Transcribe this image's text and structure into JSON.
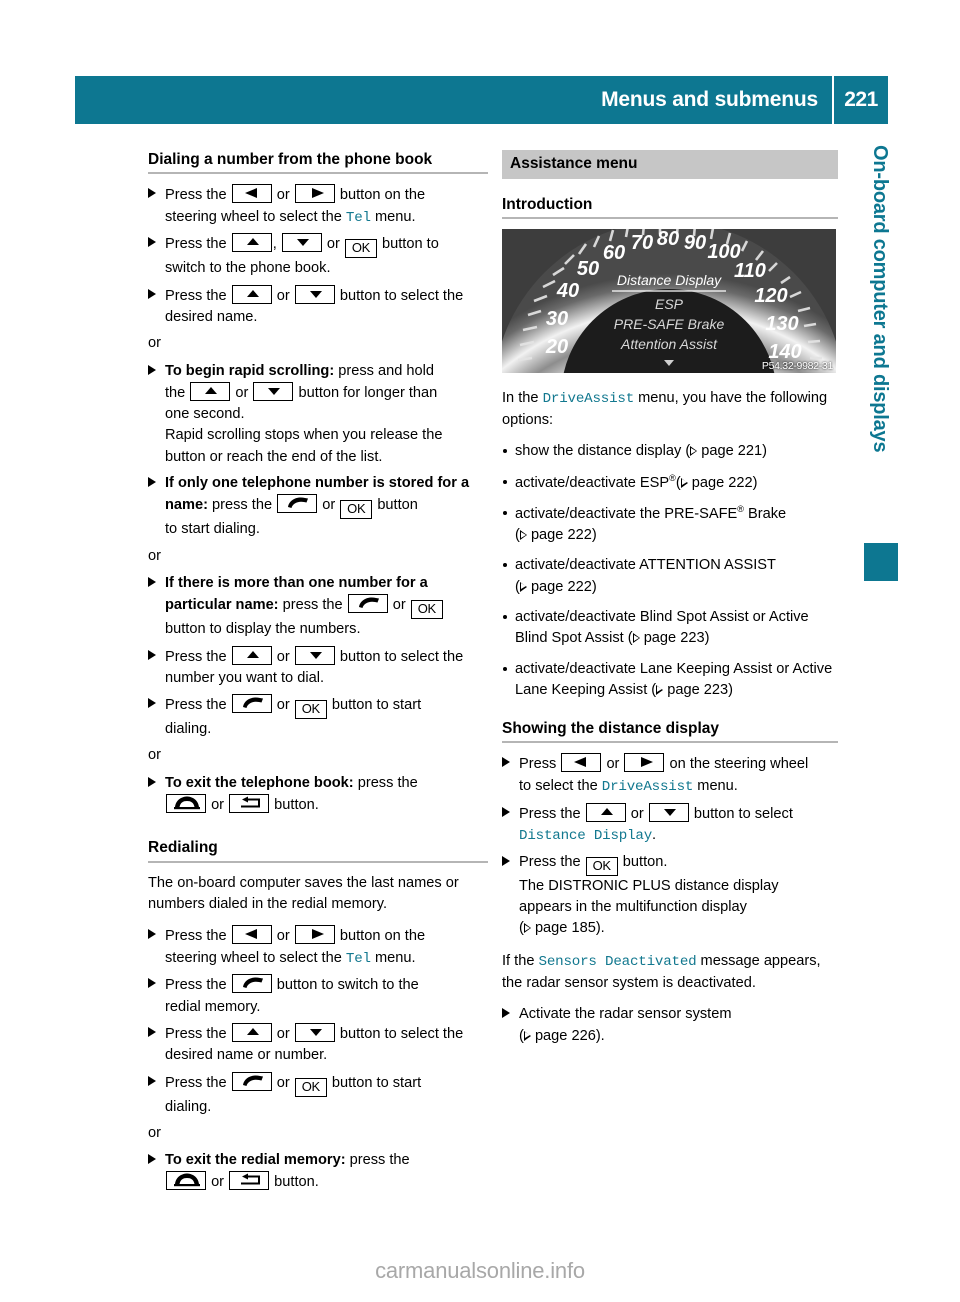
{
  "header": {
    "title": "Menus and submenus",
    "page_number": "221",
    "accent_color": "#0d7791"
  },
  "side_tab": {
    "label": "On-board computer and displays",
    "color": "#0d7791"
  },
  "watermark": "carmanualsonline.info",
  "left_column": {
    "heading1": "Dialing a number from the phone book",
    "steps1": [
      {
        "line1_a": "Press the",
        "key1": "left-arrow",
        "sep1": "or",
        "key2": "right-arrow",
        "line1_b": "button on the",
        "line2_a": "steering wheel to select the",
        "mono": "Tel",
        "line2_b": "menu."
      },
      {
        "line1_a": "Press the",
        "key1": "up-arrow",
        "sep1": ",",
        "key2": "down-arrow",
        "sep2": "or",
        "key3": "OK",
        "line1_b": "button to",
        "line2": "switch to the phone book."
      },
      {
        "line1_a": "Press the",
        "key1": "up-arrow",
        "sep1": "or",
        "key2": "down-arrow",
        "line1_b": "button to select the",
        "line2": "desired name."
      }
    ],
    "or1": "or",
    "steps2": [
      {
        "bold": "To begin rapid scrolling:",
        "line1_b": "press and hold",
        "line2_a": "the",
        "key1": "up-arrow",
        "sep1": "or",
        "key2": "down-arrow",
        "line2_b": "button for longer than",
        "line3": "one second.",
        "line4": "Rapid scrolling stops when you release the",
        "line5": "button or reach the end of the list."
      },
      {
        "bold": "If only one telephone number is stored for a name:",
        "line_b": "press the",
        "key1": "phone-pickup",
        "sep1": "or",
        "key2": "OK",
        "line_c": "button",
        "line3": "to start dialing."
      }
    ],
    "or2": "or",
    "steps3": [
      {
        "bold": "If there is more than one number for a particular name:",
        "line_b": "press the",
        "key1": "phone-pickup",
        "sep1": "or",
        "key2": "OK",
        "line3": "button to display the numbers."
      },
      {
        "line1_a": "Press the",
        "key1": "up-arrow",
        "sep1": "or",
        "key2": "down-arrow",
        "line1_b": "button to select the",
        "line2": "number you want to dial."
      },
      {
        "line1_a": "Press the",
        "key1": "phone-pickup",
        "sep1": "or",
        "key2": "OK",
        "line1_b": "button to start",
        "line2": "dialing."
      }
    ],
    "or3": "or",
    "steps4": [
      {
        "bold": "To exit the telephone book:",
        "line_b": "press the",
        "key1": "phone-hangup",
        "sep1": "or",
        "key2": "back-arrow",
        "line_c": "button."
      }
    ],
    "heading2": "Redialing",
    "para1": "The on-board computer saves the last names or numbers dialed in the redial memory.",
    "steps5": [
      {
        "line1_a": "Press the",
        "key1": "left-arrow",
        "sep1": "or",
        "key2": "right-arrow",
        "line1_b": "button on the",
        "line2_a": "steering wheel to select the",
        "mono": "Tel",
        "line2_b": "menu."
      },
      {
        "line1_a": "Press the",
        "key1": "phone-pickup",
        "line1_b": "button to switch to the",
        "line2": "redial memory."
      },
      {
        "line1_a": "Press the",
        "key1": "up-arrow",
        "sep1": "or",
        "key2": "down-arrow",
        "line1_b": "button to select the",
        "line2": "desired name or number."
      },
      {
        "line1_a": "Press the",
        "key1": "phone-pickup",
        "sep1": "or",
        "key2": "OK",
        "line1_b": "button to start",
        "line2": "dialing."
      }
    ],
    "or4": "or",
    "steps6": [
      {
        "bold": "To exit the redial memory:",
        "line_b": "press the",
        "key1": "phone-hangup",
        "sep1": "or",
        "key2": "back-arrow",
        "line_c": "button."
      }
    ]
  },
  "right_column": {
    "section_heading": "Assistance menu",
    "heading1": "Introduction",
    "figure": {
      "image_code": "P54.32-9982-31",
      "speedometer_ticks": [
        "20",
        "30",
        "40",
        "50",
        "60",
        "70",
        "80",
        "90",
        "100",
        "110",
        "120",
        "130",
        "140"
      ],
      "display_items": [
        "Distance Display",
        "ESP",
        "PRE-SAFE Brake",
        "Attention Assist"
      ],
      "selected_item": "Distance Display",
      "scroll_indicator": "down-caret"
    },
    "intro_a": "In the",
    "intro_mono": "DriveAssist",
    "intro_b": "menu, you have the following options:",
    "options": [
      {
        "text_a": "show the distance display (",
        "ref": "page 221",
        "text_b": ")"
      },
      {
        "text_a": "activate/deactivate ESP",
        "sup": "®",
        "mid": "(",
        "ref": "page 222",
        "text_b": ")"
      },
      {
        "text_a": "activate/deactivate the PRE-SAFE",
        "sup": "®",
        "mid": " Brake",
        "newline": true,
        "ref": "page 222",
        "text_b": ")"
      },
      {
        "text_a": "activate/deactivate ATTENTION ASSIST",
        "newline": true,
        "ref": "page 222",
        "text_b": ")"
      },
      {
        "text_a": "activate/deactivate Blind Spot Assist or Active Blind Spot Assist (",
        "ref": "page 223",
        "text_b": ")"
      },
      {
        "text_a": "activate/deactivate Lane Keeping Assist or Active Lane Keeping Assist (",
        "ref": "page 223",
        "text_b": ")"
      }
    ],
    "heading2": "Showing the distance display",
    "steps": [
      {
        "line1_a": "Press",
        "key1": "left-arrow",
        "sep1": "or",
        "key2": "right-arrow",
        "line1_b": "on the steering wheel",
        "line2_a": "to select the",
        "mono": "DriveAssist",
        "line2_b": "menu."
      },
      {
        "line1_a": "Press the",
        "key1": "up-arrow",
        "sep1": "or",
        "key2": "down-arrow",
        "line1_b": "button to select",
        "mono2": "Distance Display",
        "line2_b": "."
      },
      {
        "line1_a": "Press the",
        "key1": "OK",
        "line1_b": "button.",
        "line2": "The DISTRONIC PLUS distance display",
        "line3": "appears in the multifunction display",
        "line4_open": "(",
        "ref": "page 185",
        "line4_close": ")."
      }
    ],
    "para_a": "If the",
    "para_mono": "Sensors Deactivated",
    "para_b": "message appears, the radar sensor system is deactivated.",
    "last_step": {
      "line1": "Activate the radar sensor system",
      "line2_open": "(",
      "ref": "page 226",
      "line2_close": ")."
    }
  }
}
